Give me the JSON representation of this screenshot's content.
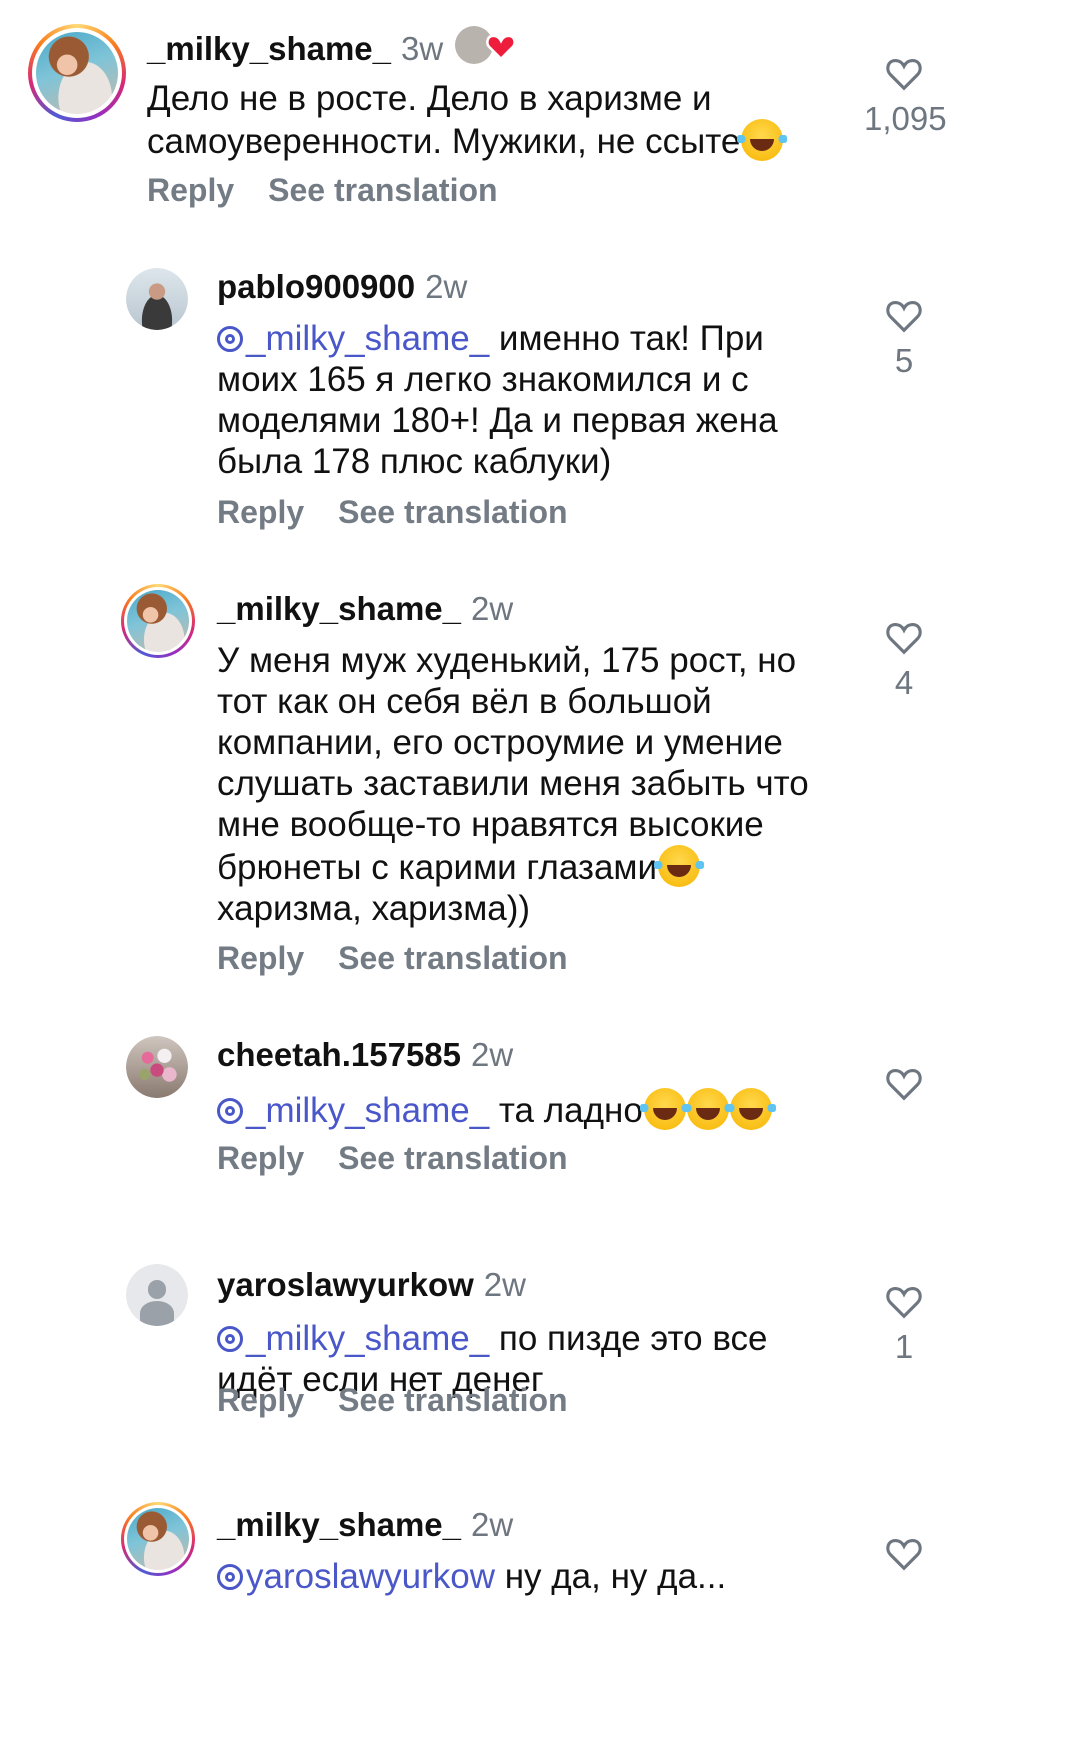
{
  "colors": {
    "mention": "#4a57c9",
    "secondary_text": "#737b84",
    "heart_red": "#ee1d3b"
  },
  "comments": [
    {
      "username": "_milky_shame_",
      "time": "3w",
      "avatar_icon": "profile-photo",
      "text_lines": [
        "Дело не в росте. Дело в харизме и",
        "самоуверенности. Мужики, не ссыте"
      ],
      "reply_label": "Reply",
      "translate_label": "See translation",
      "like_count": "1,095",
      "liked_by_creator": true
    },
    {
      "username": "pablo900900",
      "time": "2w",
      "avatar_icon": "profile-photo",
      "mention": "_milky_shame_",
      "text_lines": [
        "именно так! При",
        "моих 165 я легко знакомился и с",
        "моделями 180+! Да и первая жена",
        "была 178 плюс каблуки)"
      ],
      "reply_label": "Reply",
      "translate_label": "See translation",
      "like_count": "5"
    },
    {
      "username": "_milky_shame_",
      "time": "2w",
      "avatar_icon": "profile-photo",
      "text_lines": [
        "У меня муж худенький, 175 рост, но",
        "тот как он себя вёл в большой",
        "компании, его остроумие и умение",
        "слушать заставили меня забыть что",
        "мне вообще-то нравятся высокие",
        "брюнеты с карими глазами",
        "харизма, харизма))"
      ],
      "reply_label": "Reply",
      "translate_label": "See translation",
      "like_count": "4"
    },
    {
      "username": "cheetah.157585",
      "time": "2w",
      "avatar_icon": "profile-photo",
      "mention": "_milky_shame_",
      "text_lines": [
        "та ладно"
      ],
      "reply_label": "Reply",
      "translate_label": "See translation",
      "like_count": ""
    },
    {
      "username": "yaroslawyurkow",
      "time": "2w",
      "avatar_icon": "default-avatar",
      "mention": "_milky_shame_",
      "text_lines": [
        "по пизде это все",
        "идёт если нет денег"
      ],
      "reply_label": "Reply",
      "translate_label": "See translation",
      "like_count": "1"
    },
    {
      "username": "_milky_shame_",
      "time": "2w",
      "avatar_icon": "profile-photo",
      "mention": "yaroslawyurkow",
      "text_lines": [
        "ну да, ну да..."
      ],
      "like_count": ""
    }
  ]
}
